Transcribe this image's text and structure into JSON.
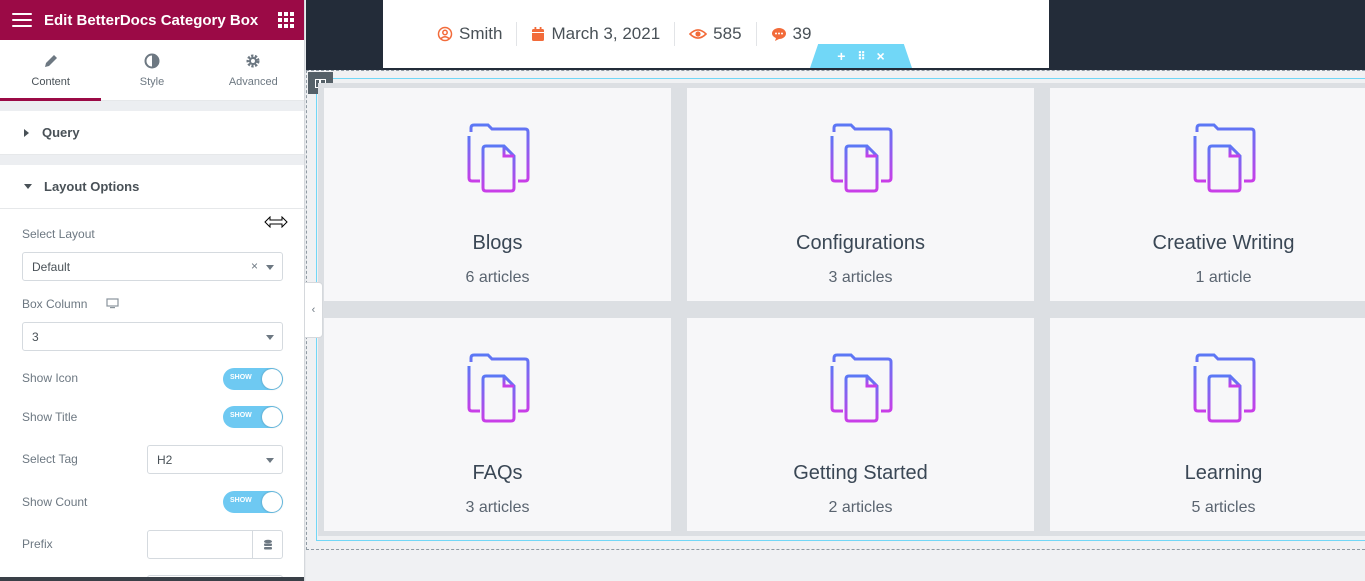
{
  "editor": {
    "title": "Edit BetterDocs Category Box",
    "tabs": [
      {
        "label": "Content",
        "icon": "pencil-icon"
      },
      {
        "label": "Style",
        "icon": "half-circle-icon"
      },
      {
        "label": "Advanced",
        "icon": "gear-icon"
      }
    ],
    "sections": {
      "query": "Query",
      "layout": "Layout Options"
    },
    "controls": {
      "select_layout_label": "Select Layout",
      "select_layout_value": "Default",
      "box_column_label": "Box Column",
      "box_column_value": "3",
      "show_icon_label": "Show Icon",
      "show_title_label": "Show Title",
      "select_tag_label": "Select Tag",
      "select_tag_value": "H2",
      "show_count_label": "Show Count",
      "prefix_label": "Prefix",
      "toggle_text": "SHOW"
    }
  },
  "post_meta": {
    "author": "Smith",
    "date": "March 3, 2021",
    "views": "585",
    "comments": "39"
  },
  "categories": [
    {
      "title": "Blogs",
      "count": "6 articles"
    },
    {
      "title": "Configurations",
      "count": "3 articles"
    },
    {
      "title": "Creative Writing",
      "count": "1 article"
    },
    {
      "title": "FAQs",
      "count": "3 articles"
    },
    {
      "title": "Getting Started",
      "count": "2 articles"
    },
    {
      "title": "Learning",
      "count": "5 articles"
    }
  ],
  "colors": {
    "brand": "#9b0a46",
    "accent": "#71d7f7",
    "meta_icon": "#f26b3a"
  }
}
